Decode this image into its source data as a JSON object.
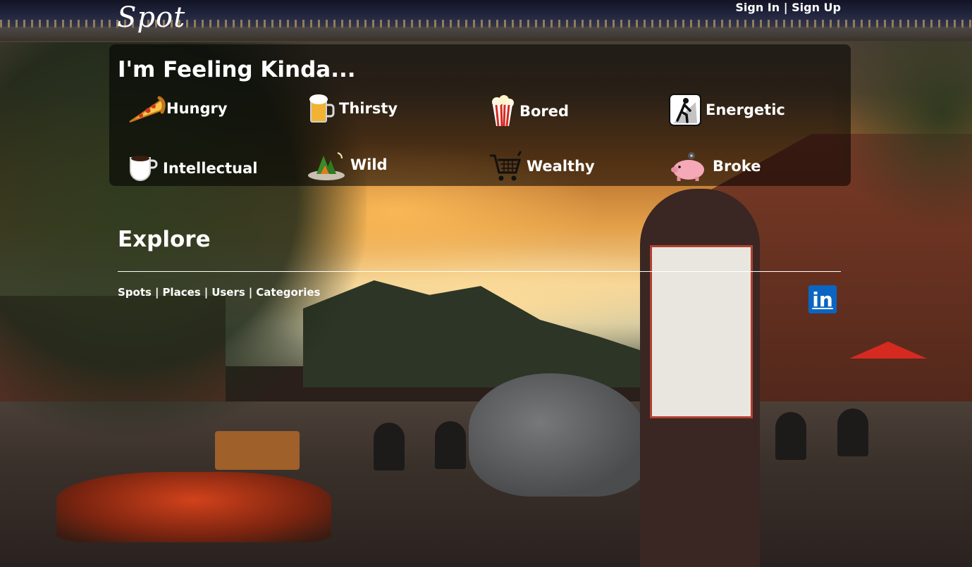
{
  "header": {
    "logo": "Spot",
    "sign_in": "Sign In",
    "separator": "|",
    "sign_up": "Sign Up"
  },
  "feeling": {
    "title": "I'm Feeling Kinda...",
    "moods": [
      {
        "label": "Hungry",
        "icon": "pizza-icon"
      },
      {
        "label": "Thirsty",
        "icon": "beer-icon"
      },
      {
        "label": "Bored",
        "icon": "popcorn-icon"
      },
      {
        "label": "Energetic",
        "icon": "hiker-icon"
      },
      {
        "label": "Intellectual",
        "icon": "coffee-icon"
      },
      {
        "label": "Wild",
        "icon": "campsite-icon"
      },
      {
        "label": "Wealthy",
        "icon": "shopping-cart-icon"
      },
      {
        "label": "Broke",
        "icon": "piggy-bank-icon"
      }
    ]
  },
  "explore": {
    "title": "Explore",
    "links": [
      "Spots",
      "Places",
      "Users",
      "Categories"
    ],
    "separator": "|"
  },
  "social": {
    "linkedin_text": "in",
    "linkedin_color": "#0a66c2"
  }
}
